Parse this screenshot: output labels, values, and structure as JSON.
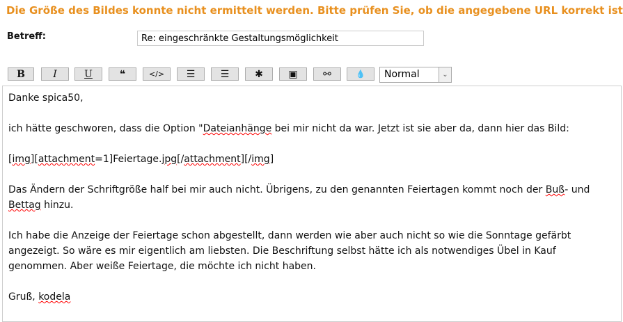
{
  "error": "Die Größe des Bildes konnte nicht ermittelt werden. Bitte prüfen Sie, ob die angegebene URL korrekt ist.",
  "subject": {
    "label": "Betreff:",
    "value": "Re: eingeschränkte Gestaltungsmöglichkeit"
  },
  "toolbar": {
    "bold": "B",
    "italic": "I",
    "underline": "U",
    "quote": "❝",
    "code": "</>",
    "list": "☰",
    "olist": "☰",
    "star": "✱",
    "image": "▣",
    "link": "⚯",
    "color": "💧",
    "size": "Normal",
    "arrow": "⌄"
  },
  "body": {
    "l1": "Danke spica50,",
    "l2a": "ich hätte geschworen, dass die Option \"",
    "l2b": "Dateianhänge",
    "l2c": " bei mir nicht da war. Jetzt ist sie aber da, dann hier das Bild:",
    "l3a": "[",
    "l3b": "img",
    "l3c": "][",
    "l3d": "attachment",
    "l3e": "=1]Feiertage.",
    "l3f": "jpg",
    "l3g": "[/",
    "l3h": "attachment",
    "l3i": "][/",
    "l3j": "img",
    "l3k": "]",
    "l4a": "Das Ändern der Schriftgröße half bei mir auch nicht. Übrigens, zu den genannten Feiertagen kommt noch der ",
    "l4b": "Buß",
    "l4c": "- und ",
    "l4d": "Bettag",
    "l4e": " hinzu.",
    "l5": "Ich habe die Anzeige der Feiertage schon abgestellt, dann werden wie aber auch nicht so wie die Sonntage gefärbt angezeigt. So wäre es mir eigentlich am liebsten. Die Beschriftung selbst hätte ich als notwendiges Übel in Kauf genommen. Aber weiße Feiertage, die möchte ich nicht haben.",
    "l6a": "Gruß, ",
    "l6b": "kodela"
  }
}
